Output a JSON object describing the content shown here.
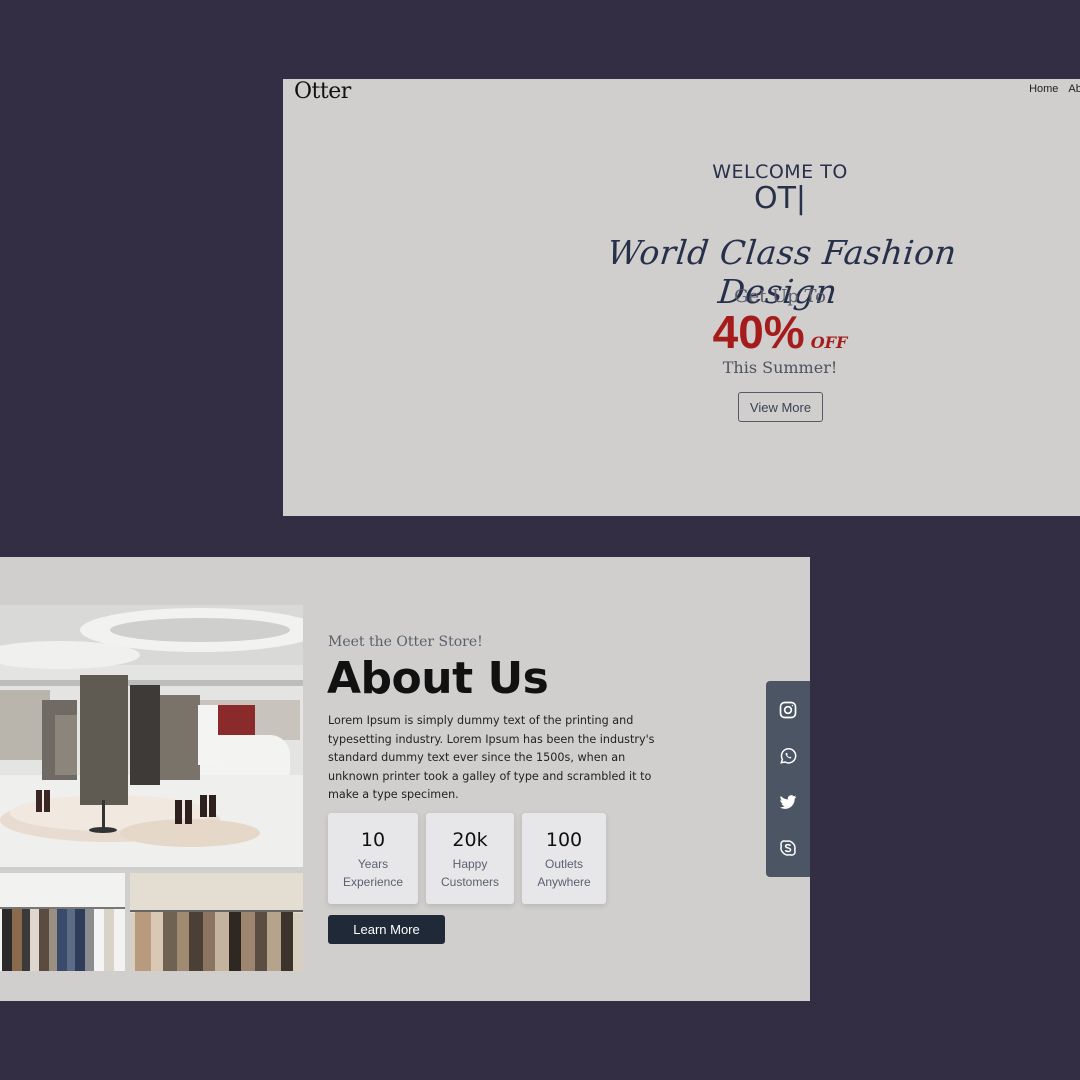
{
  "hero": {
    "logo": "Otter",
    "nav": [
      "Home",
      "Abo"
    ],
    "welcome": "WELCOME TO",
    "typed_text": "OT|",
    "tagline": "World Class Fashion Design",
    "promo_prefix": "Get Up To",
    "promo_percent": "40%",
    "promo_off": "OFF",
    "promo_suffix": "This Summer!",
    "button_label": "View More"
  },
  "about": {
    "subtitle": "Meet the Otter Store!",
    "title": "About Us",
    "description": "Lorem Ipsum is simply dummy text of the printing and typesetting industry. Lorem Ipsum has been the industry's standard dummy text ever since the 1500s, when an unknown printer took a galley of type and scrambled it to make a type specimen.",
    "stats": [
      {
        "value": "10",
        "label_line1": "Years",
        "label_line2": "Experience"
      },
      {
        "value": "20k",
        "label_line1": "Happy",
        "label_line2": "Customers"
      },
      {
        "value": "100",
        "label_line1": "Outlets",
        "label_line2": "Anywhere"
      }
    ],
    "button_label": "Learn More",
    "social_icons": [
      "instagram-icon",
      "whatsapp-icon",
      "twitter-icon",
      "skype-icon"
    ]
  },
  "colors": {
    "background": "#332e44",
    "panel": "#d0cfcd",
    "accent_red": "#a51c1c",
    "dark_button": "#1f2937",
    "social_bar": "#4b5563"
  }
}
